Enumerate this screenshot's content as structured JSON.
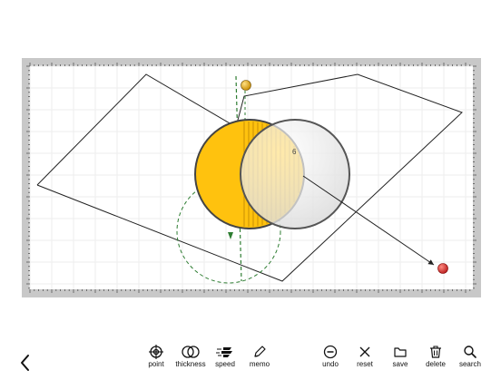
{
  "canvas": {
    "point_label": "6",
    "colors": {
      "yellow": "#ffc20e",
      "guide_green": "#2e7d32",
      "marker_red": "#c62828",
      "marker_orange": "#e0a100"
    }
  },
  "toolbar": {
    "back_icon": "chevron-left-icon",
    "items": [
      {
        "label": "point",
        "icon": "crosshair-icon"
      },
      {
        "label": "thickness",
        "icon": "overlap-circles-icon"
      },
      {
        "label": "speed",
        "icon": "speed-icon"
      },
      {
        "label": "memo",
        "icon": "pencil-icon"
      },
      {
        "label": "undo",
        "icon": "undo-icon"
      },
      {
        "label": "reset",
        "icon": "x-icon"
      },
      {
        "label": "save",
        "icon": "folder-icon"
      },
      {
        "label": "delete",
        "icon": "trash-icon"
      },
      {
        "label": "search",
        "icon": "search-icon"
      }
    ]
  }
}
